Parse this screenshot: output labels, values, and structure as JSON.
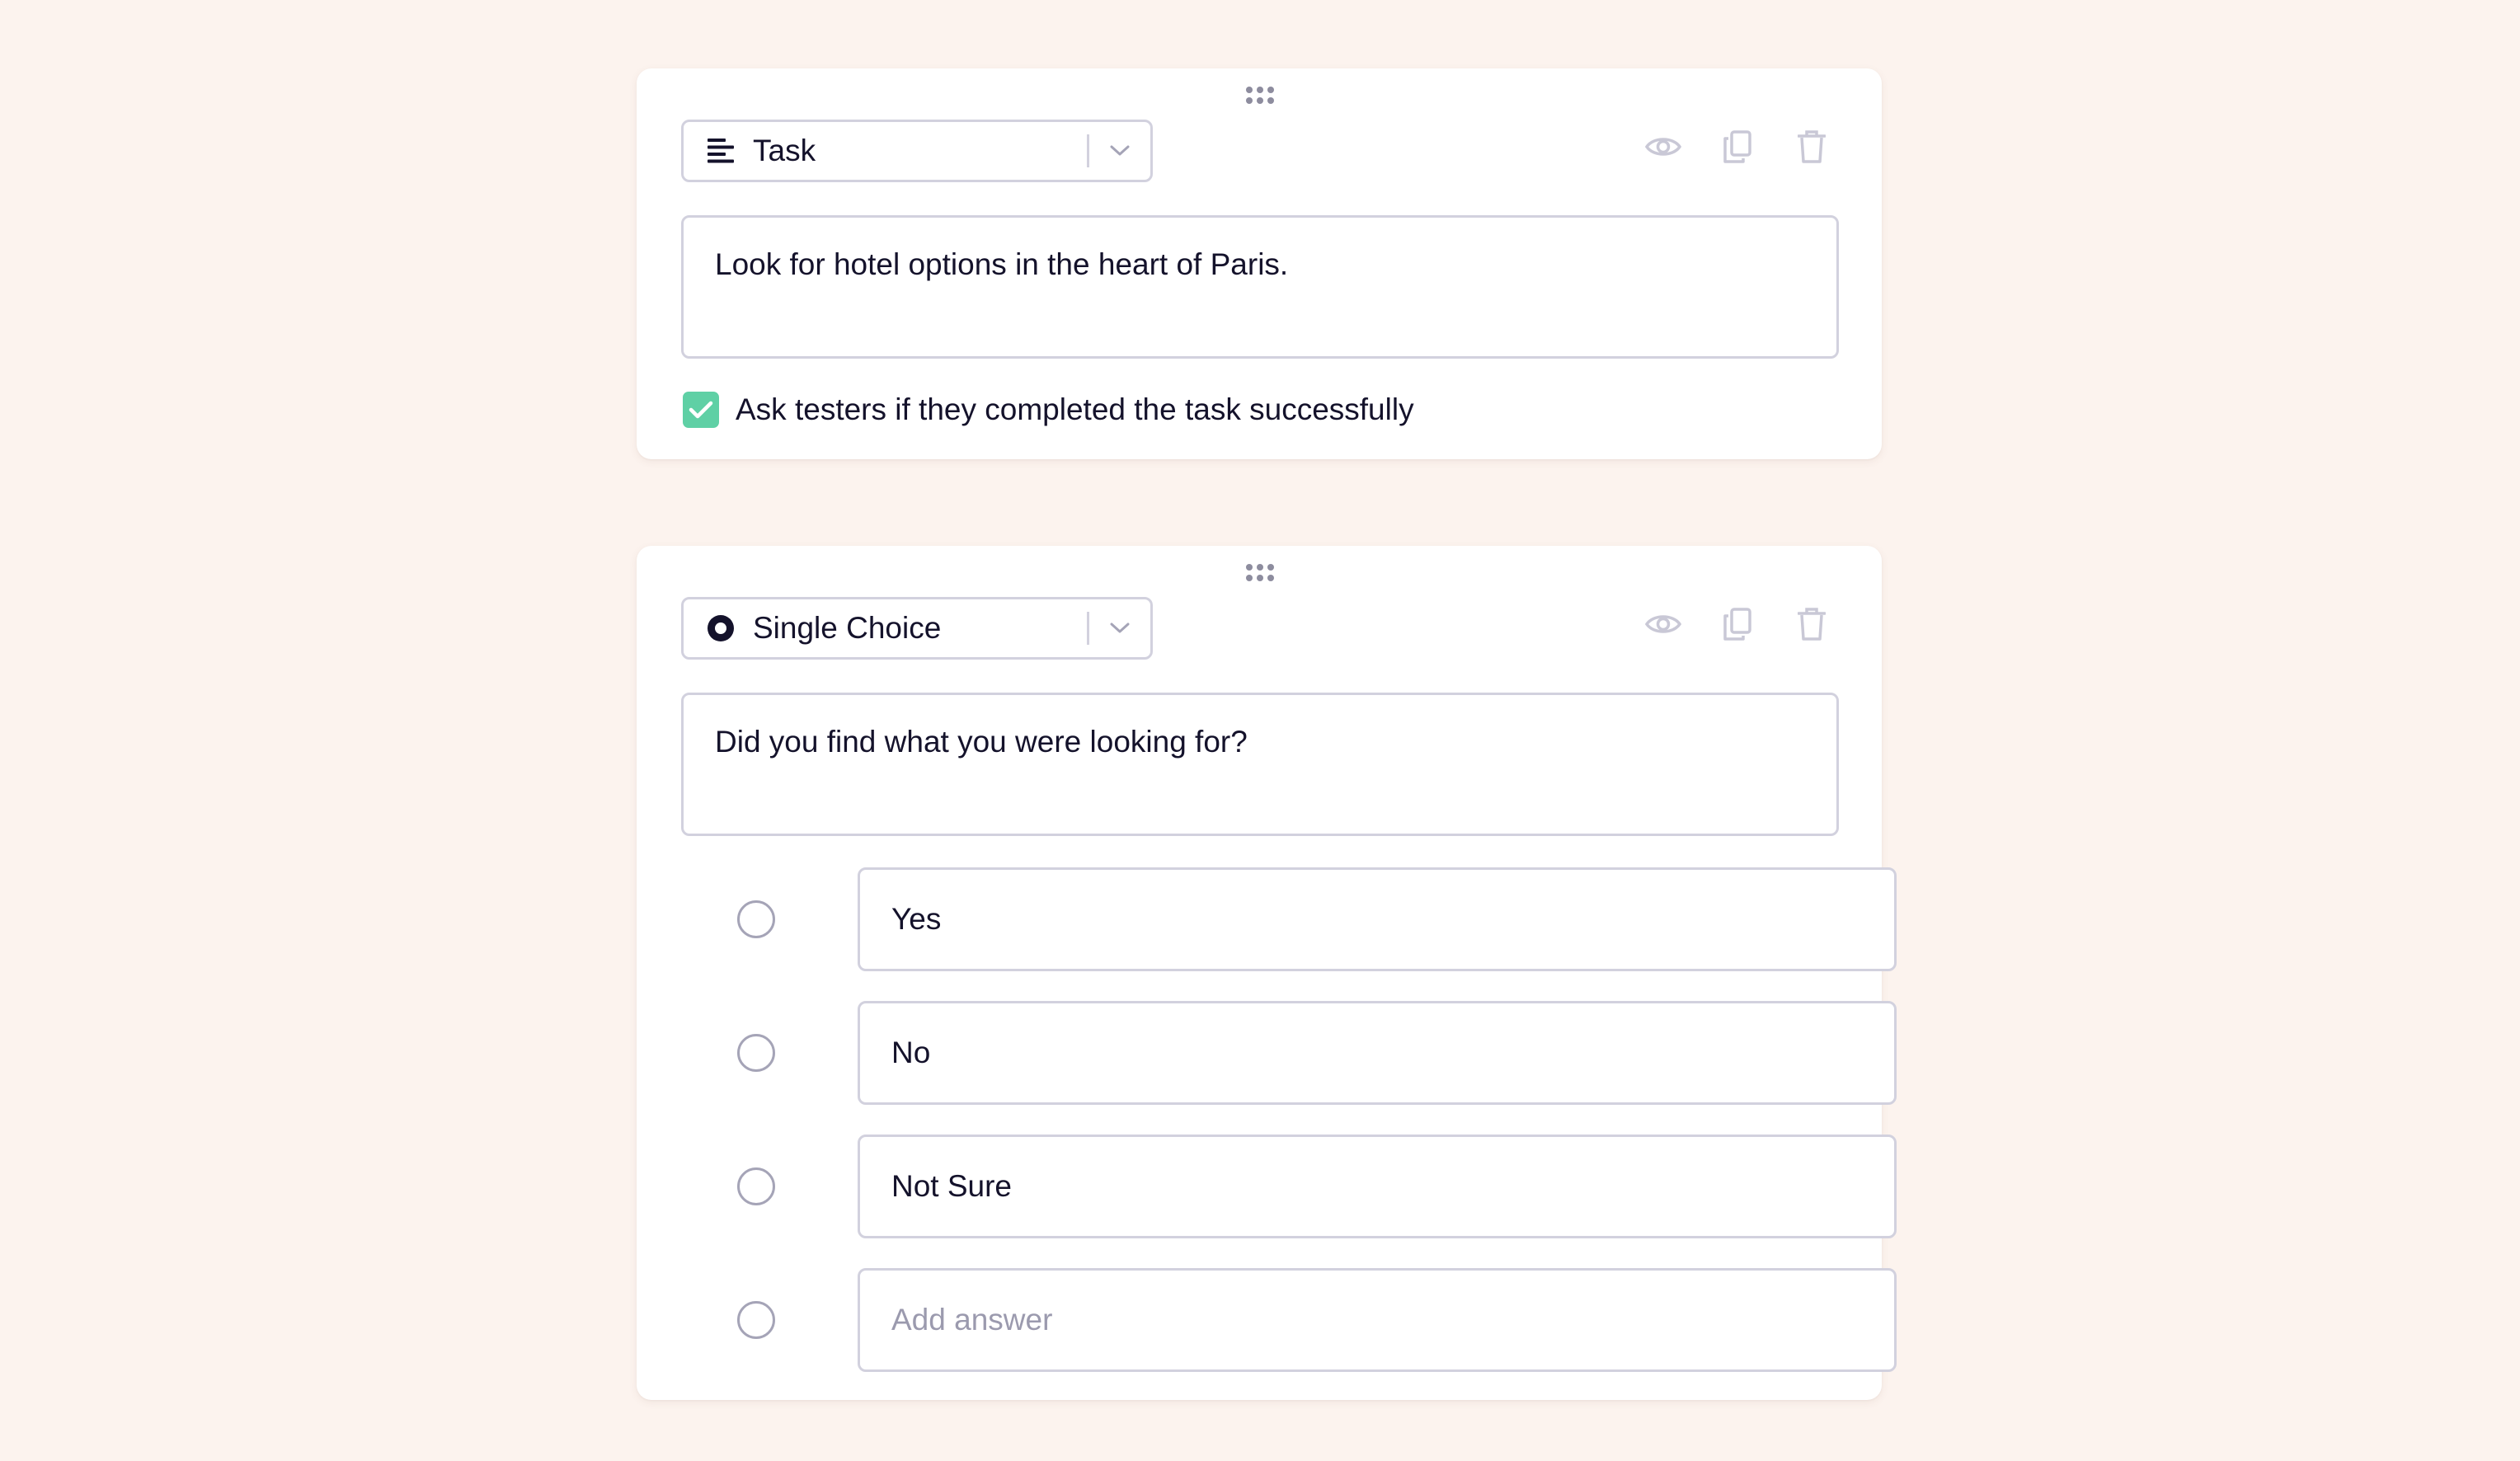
{
  "cards": [
    {
      "type_label": "Task",
      "type_icon": "align-left-icon",
      "prompt": "Look for hotel options in the heart of Paris.",
      "checkbox": {
        "checked": true,
        "label": "Ask testers if they completed the task successfully"
      }
    },
    {
      "type_label": "Single Choice",
      "type_icon": "radio-selected-icon",
      "prompt": "Did you find what you were looking for?",
      "answers": [
        "Yes",
        "No",
        "Not Sure"
      ],
      "add_answer_placeholder": "Add answer"
    }
  ],
  "actions": [
    "eye-icon",
    "duplicate-icon",
    "trash-icon"
  ],
  "colors": {
    "background": "#fcf3ee",
    "card": "#ffffff",
    "border": "#d2d1de",
    "text": "#14122b",
    "checkbox_accent": "#5fd0a5",
    "muted_icon": "#c9c8d6"
  }
}
